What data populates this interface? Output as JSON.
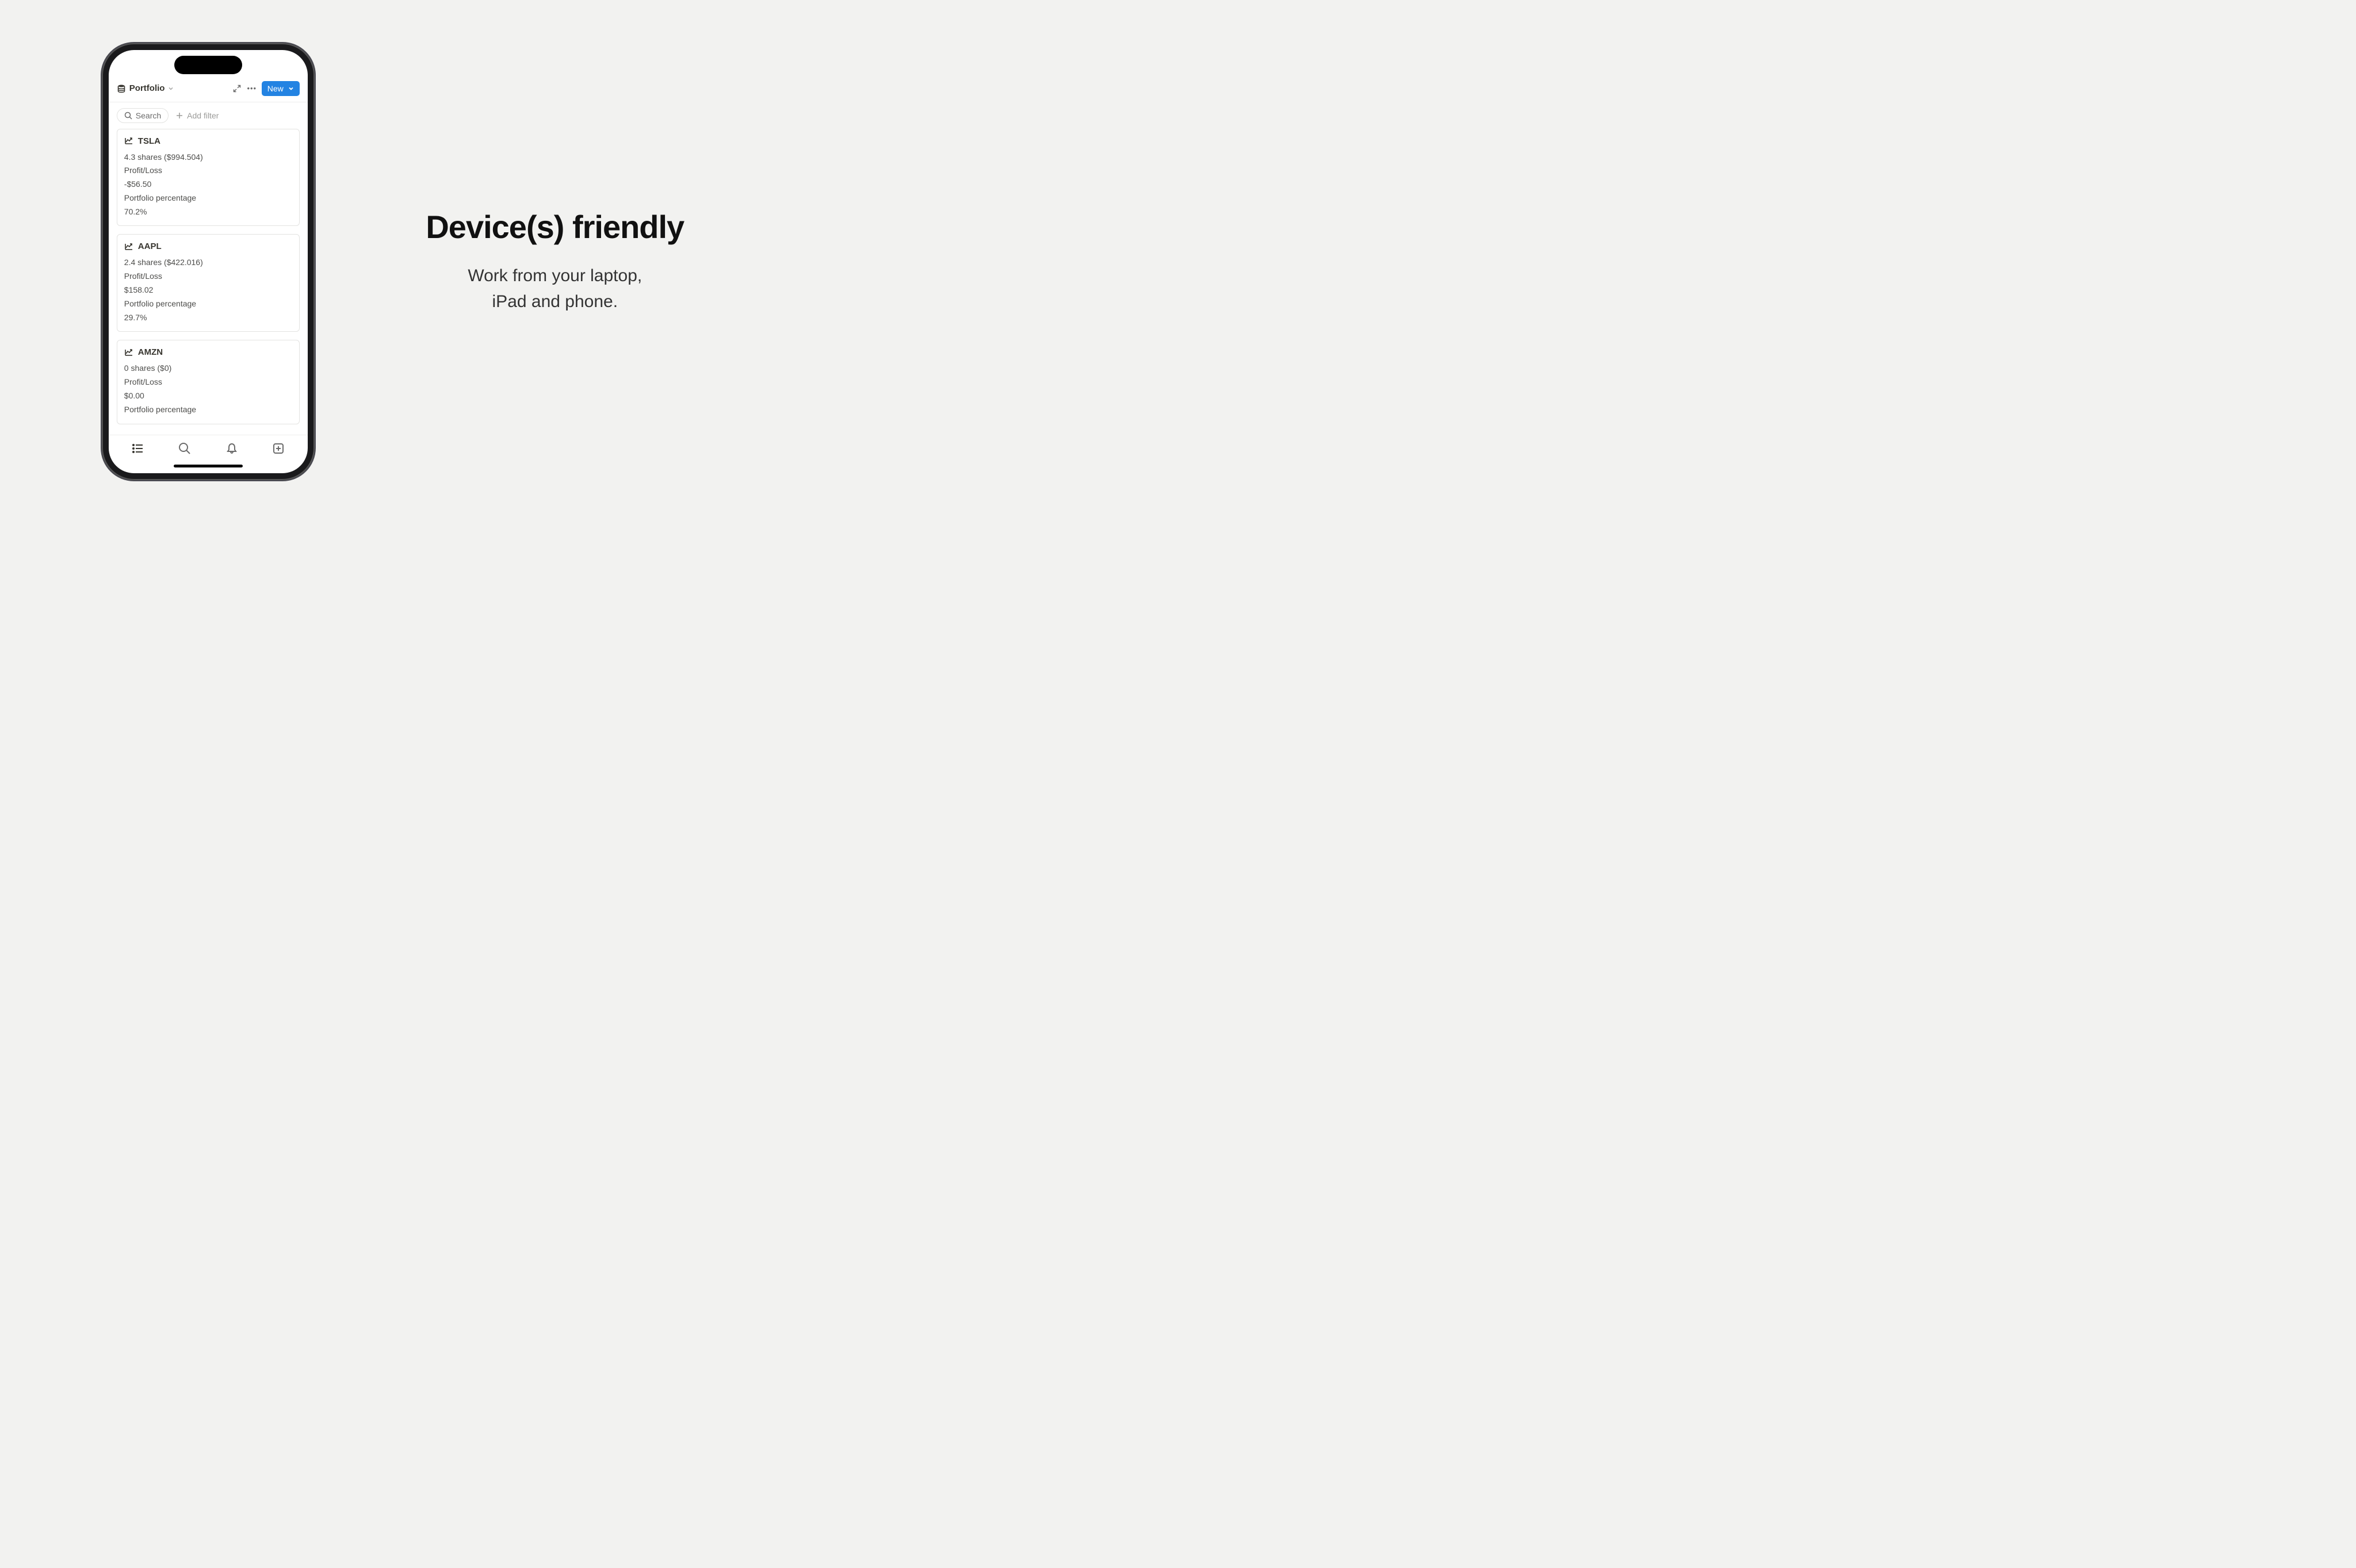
{
  "header": {
    "title": "Portfolio",
    "new_label": "New"
  },
  "filters": {
    "search_label": "Search",
    "add_filter_label": "Add filter"
  },
  "labels": {
    "profit_loss": "Profit/Loss",
    "portfolio_pct": "Portfolio percentage"
  },
  "cards": [
    {
      "ticker": "TSLA",
      "shares_line": "4.3 shares ($994.504)",
      "pl": "-$56.50",
      "pct": "70.2%"
    },
    {
      "ticker": "AAPL",
      "shares_line": "2.4 shares ($422.016)",
      "pl": "$158.02",
      "pct": "29.7%"
    },
    {
      "ticker": "AMZN",
      "shares_line": "0 shares ($0)",
      "pl": "$0.00",
      "pct": ""
    }
  ],
  "marketing": {
    "headline": "Device(s) friendly",
    "subhead_line1": "Work from your laptop,",
    "subhead_line2": "iPad and phone."
  }
}
